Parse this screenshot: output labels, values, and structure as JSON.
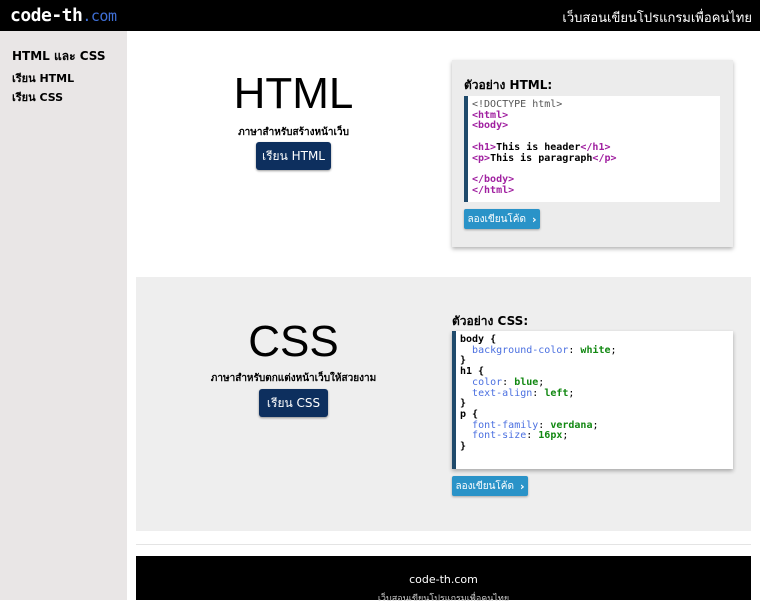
{
  "header": {
    "logo_main": "code-th",
    "logo_suffix": ".com",
    "tagline": "เว็บสอนเขียนโปรแกรมเพื่อคนไทย"
  },
  "sidebar": {
    "title": "HTML และ CSS",
    "items": [
      {
        "label": "เรียน HTML"
      },
      {
        "label": "เรียน CSS"
      }
    ]
  },
  "html_section": {
    "title": "HTML",
    "subtitle": "ภาษาสำหรับสร้างหน้าเว็บ",
    "button": "เรียน HTML",
    "example_heading": "ตัวอย่าง HTML:",
    "try_button": "ลองเขียนโค้ด"
  },
  "css_section": {
    "title": "CSS",
    "subtitle": "ภาษาสำหรับตกแต่งหน้าเว็บให้สวยงาม",
    "button": "เรียน CSS",
    "example_heading": "ตัวอย่าง CSS:",
    "try_button": "ลองเขียนโค้ด"
  },
  "footer": {
    "title": "code-th.com",
    "subtitle": "เว็บสอนเขียนโปรแกรมเพื่อคนไทย"
  },
  "colors": {
    "header_bg": "#000000",
    "accent_dark": "#0d2f5e",
    "accent_blue": "#2a93c8",
    "tag_purple": "#a020a0",
    "value_green": "#128812",
    "prop_blue": "#4a6fe0"
  },
  "icons": [
    "chevron-right-icon"
  ]
}
